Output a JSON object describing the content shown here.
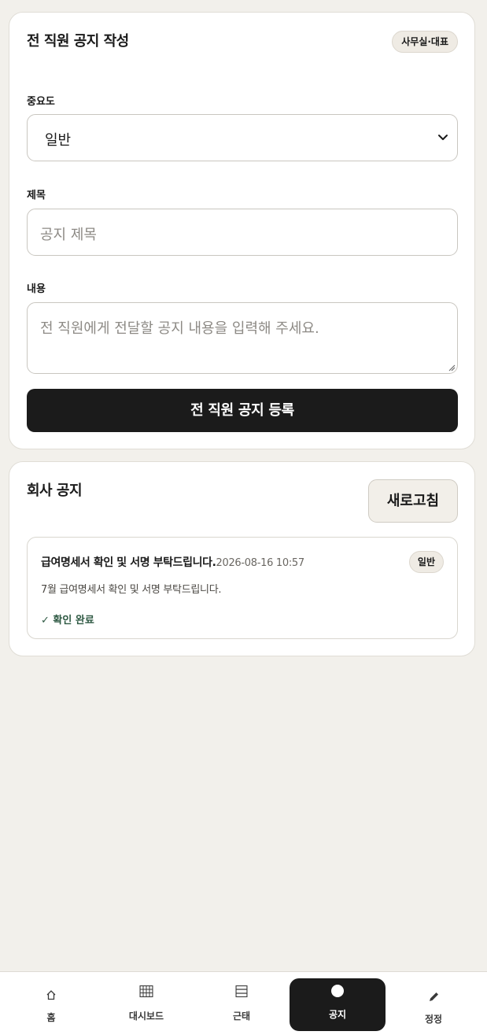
{
  "compose": {
    "title": "전 직원 공지 작성",
    "role_badge": "사무실·대표",
    "importance_label": "중요도",
    "importance_value": "일반",
    "title_label": "제목",
    "title_placeholder": "공지 제목",
    "content_label": "내용",
    "content_placeholder": "전 직원에게 전달할 공지 내용을 입력해 주세요.",
    "submit_label": "전 직원 공지 등록"
  },
  "notices": {
    "title": "회사 공지",
    "refresh_label": "새로고침",
    "items": [
      {
        "title": "급여명세서 확인 및 서명 부탁드립니다.",
        "date": "2026-08-16 10:57",
        "level": "일반",
        "body": "7월 급여명세서 확인 및 서명 부탁드립니다.",
        "status": "✓ 확인 완료"
      }
    ]
  },
  "tabbar": {
    "active_color": "#1b1b1b",
    "tabs": [
      {
        "label": "홈",
        "icon": "home-icon",
        "active": false
      },
      {
        "label": "대시보드",
        "icon": "grid-icon",
        "active": false
      },
      {
        "label": "근태",
        "icon": "list-icon",
        "active": false
      },
      {
        "label": "공지",
        "icon": "dot-icon",
        "active": true
      },
      {
        "label": "정정",
        "icon": "pencil-icon",
        "active": false
      }
    ]
  }
}
